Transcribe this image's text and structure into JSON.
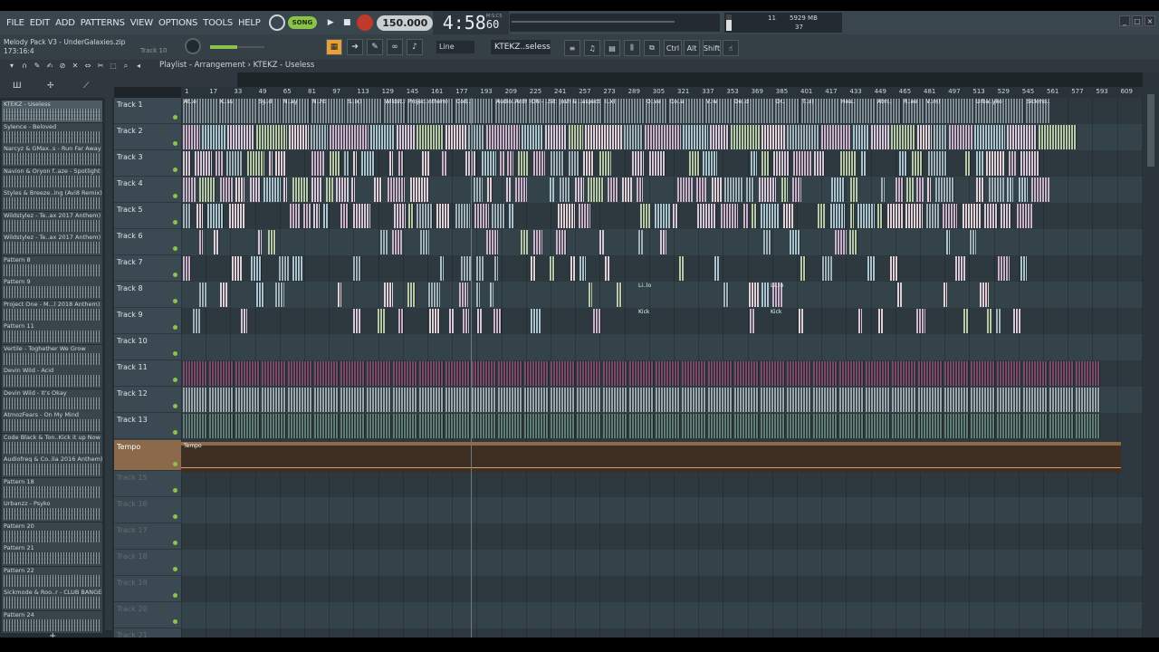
{
  "menu": [
    "FILE",
    "EDIT",
    "ADD",
    "PATTERNS",
    "VIEW",
    "OPTIONS",
    "TOOLS",
    "HELP"
  ],
  "transport": {
    "song_label": "SONG",
    "tempo": "150.000",
    "time_main": "4:58",
    "time_sub": "60",
    "time_unit": "M:S:CS"
  },
  "cpu": {
    "voices": "11",
    "memory": "5929 MB",
    "polyphony": "37"
  },
  "project": {
    "name": "Melody Pack V3 - UnderGalaxies.zip",
    "position": "173:16:4",
    "hint_track": "Track 10"
  },
  "toolbar": {
    "snap": "Line",
    "pattern": "KTEKZ..seless",
    "keys": [
      "Ctrl",
      "Alt",
      "Shift"
    ]
  },
  "playlist": {
    "title": "Playlist - Arrangement › KTEKZ - Useless"
  },
  "picker": [
    "KTEKZ - Useless",
    "Sylence - Beloved",
    "Narcyz & GMax..s - Run Far Away",
    "Navion & Oryon f..aze - Spotlight",
    "Styles & Breeze..ing (Avi8 Remix)",
    "Wildstylez - Te..ax 2017 Anthem)",
    "Wildstylez - Te..ax 2017 Anthem)",
    "Pattern 8",
    "Pattern 9",
    "Project One - M...l 2018 Anthem)",
    "Pattern 11",
    "Vertile - Toghether We Grow",
    "Devin Wild - Acid",
    "Devin Wild - It's Okay",
    "AtmozFears - On My Mind",
    "Code Black & Ton..Kick it up Now",
    "Audiofreq & Co..lia 2016 Anthem)",
    "Pattern 18",
    "Urbanzz - Psyko",
    "Pattern 20",
    "Pattern 21",
    "Pattern 22",
    "Sickmode & Roo..r - CLUB BANGER",
    "Pattern 24"
  ],
  "tracks": [
    "Track 1",
    "Track 2",
    "Track 3",
    "Track 4",
    "Track 5",
    "Track 6",
    "Track 7",
    "Track 8",
    "Track 9",
    "Track 10",
    "Track 11",
    "Track 12",
    "Track 13",
    "Tempo",
    "Track 15",
    "Track 16",
    "Track 17",
    "Track 18",
    "Track 19",
    "Track 20",
    "Track 21"
  ],
  "ruler": [
    "1",
    "17",
    "33",
    "49",
    "65",
    "81",
    "97",
    "113",
    "129",
    "145",
    "161",
    "177",
    "193",
    "209",
    "225",
    "241",
    "257",
    "273",
    "289",
    "305",
    "321",
    "337",
    "353",
    "369",
    "385",
    "401",
    "417",
    "433",
    "449",
    "465",
    "481",
    "497",
    "513",
    "529",
    "545",
    "561",
    "577",
    "593",
    "609"
  ],
  "clip_labels": [
    "At..e",
    "K..ss",
    "Sy..d",
    "N..ay",
    "N..ht",
    "S..ix)",
    "Wildst..them)",
    "Projec..nthem)",
    "Cod..",
    "Audio..Anthem)",
    "ION - ..Sit",
    "Josh & ..aspect",
    "I..x)",
    "O..ve",
    "Co..a",
    "V..w",
    "De..d",
    "Dr..",
    "T..x)",
    "Hea..",
    "Atm..",
    "R..ee",
    "V..m)",
    "Urba..yko",
    "Sickmo..ANGER",
    "Sl..D",
    "Camelli..ound)"
  ],
  "misc": {
    "tempo_clip": "Tempo",
    "kick": "Kick",
    "li_lo": "Li..lo"
  },
  "colors": {
    "accent_green": "#8bc34a",
    "accent_orange": "#e8a13a",
    "tempo_track": "#8a6a4a"
  }
}
